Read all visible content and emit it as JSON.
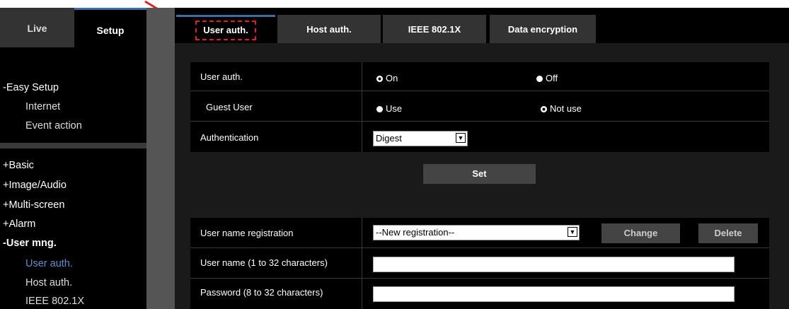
{
  "nav": {
    "tabs": {
      "live": "Live",
      "setup": "Setup"
    },
    "easy_setup": "-Easy Setup",
    "easy_items": [
      "Internet",
      "Event action"
    ],
    "sections": [
      "+Basic",
      "+Image/Audio",
      "+Multi-screen",
      "+Alarm",
      "-User mng."
    ],
    "user_mng_items": [
      "User auth.",
      "Host auth.",
      "IEEE 802.1X"
    ]
  },
  "main": {
    "tabs": [
      "User auth.",
      "Host auth.",
      "IEEE 802.1X",
      "Data encryption"
    ],
    "settings": {
      "user_auth": {
        "label": "User auth.",
        "options": [
          "On",
          "Off"
        ],
        "selected": "On"
      },
      "guest_user": {
        "label": "Guest User",
        "options": [
          "Use",
          "Not use"
        ],
        "selected": "Not use"
      },
      "authentication": {
        "label": "Authentication",
        "value": "Digest"
      },
      "set_label": "Set"
    },
    "registration": {
      "label": "User name registration",
      "value": "--New registration--",
      "change_label": "Change",
      "delete_label": "Delete",
      "username_label": "User name (1 to 32 characters)",
      "password_label": "Password (8 to 32 characters)"
    }
  },
  "colors": {
    "accent": "#3f6ea6",
    "highlight": "#e02020",
    "active_link": "#5f8fd2"
  }
}
